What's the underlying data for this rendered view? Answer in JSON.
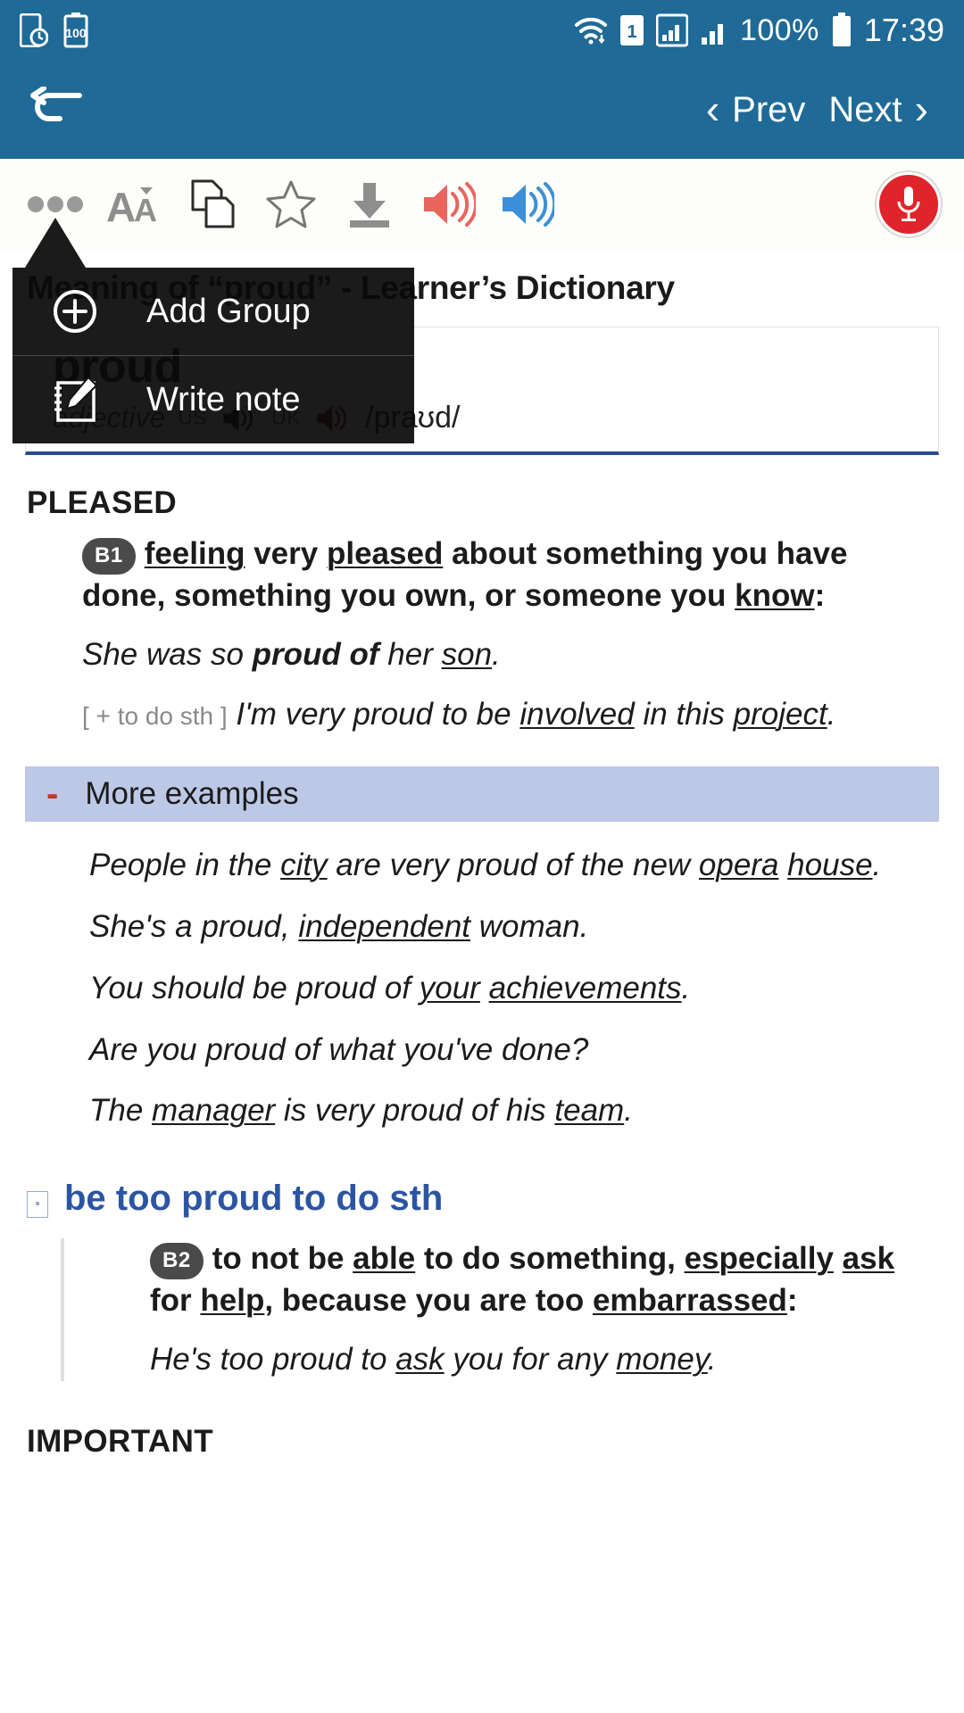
{
  "statusbar": {
    "left_icons": [
      "screenshot-icon",
      "battery-saver-icon"
    ],
    "battery_saver_text": "100",
    "right_icons": [
      "wifi-icon",
      "sim-1-icon",
      "signal-bars-icon",
      "signal-bars-2-icon",
      "battery-icon"
    ],
    "sim_label": "1",
    "battery_percent": "100%",
    "clock": "17:39"
  },
  "navbar": {
    "back_icon": "back-arrow-icon",
    "prev_label": "Prev",
    "next_label": "Next",
    "prev_chevron": "‹",
    "next_chevron": "›",
    "bg_color": "#1f6a96"
  },
  "toolbar": {
    "items": [
      {
        "name": "more-options-icon",
        "label": "More options"
      },
      {
        "name": "font-size-icon",
        "label": "Font size"
      },
      {
        "name": "copy-icon",
        "label": "Copy"
      },
      {
        "name": "favorite-star-icon",
        "label": "Favorite"
      },
      {
        "name": "download-icon",
        "label": "Download"
      },
      {
        "name": "speaker-red-icon",
        "label": "Speak US"
      },
      {
        "name": "speaker-blue-icon",
        "label": "Speak UK"
      }
    ],
    "mic_button": {
      "name": "microphone-record-button",
      "color": "#e0242b"
    }
  },
  "popup": {
    "items": [
      {
        "icon": "plus-circle-icon",
        "label": "Add Group"
      },
      {
        "icon": "write-note-icon",
        "label": "Write note"
      }
    ]
  },
  "page": {
    "title": "Meaning of “proud” - Learner’s Dictionary",
    "headword": "proud",
    "part_of_speech": "adjective",
    "us_label": "US",
    "uk_label": "UK",
    "ipa": "/praʊd/",
    "sense_heading": "PLEASED",
    "level_b1": "B1",
    "level_b2": "B2",
    "definition_1_a": "feeling",
    "definition_1_b": "very",
    "definition_1_c": "pleased",
    "definition_1_d": "about something you have done, something you own, or someone you",
    "definition_1_e": "know",
    "definition_1_f": ":",
    "example_1": "She was so proud of her son.",
    "example_2_gram": "[ + to do sth ]",
    "example_2": "I'm very proud to be involved in this project.",
    "more_examples_label": "More examples",
    "more_examples_toggle": "-",
    "more_examples": [
      "People in the city are very proud of the new opera house.",
      "She's a proud, independent woman.",
      "You should be proud of your achievements.",
      "Are you proud of what you've done?",
      "The manager is very proud of his team."
    ],
    "phrase_title": "be too proud to do sth",
    "phrase_definition": "to not be able to do something, especially ask for help, because you are too embarrassed:",
    "phrase_example": "He's too proud to ask you for any money.",
    "next_heading": "IMPORTANT"
  },
  "colors": {
    "header_blue": "#1f6a96",
    "accent_blue": "#2b55a2",
    "moreexamples_band": "#bcc8e6",
    "level_badge": "#4a4a4a",
    "speaker_red": "#e8655e",
    "speaker_blue": "#3d8fd8"
  }
}
